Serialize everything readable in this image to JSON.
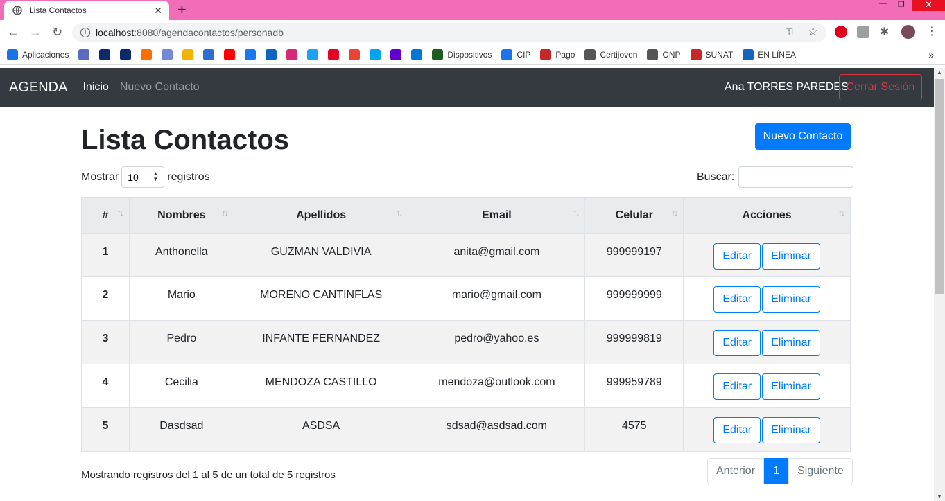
{
  "browser": {
    "tab_title": "Lista Contactos",
    "url_host": "localhost",
    "url_path": ":8080/agendacontactos/personadb",
    "bookmarks": [
      {
        "label": "Aplicaciones",
        "color": "#1a73e8"
      },
      {
        "label": "",
        "color": "#5b6bbf"
      },
      {
        "label": "",
        "color": "#0a2a6b"
      },
      {
        "label": "",
        "color": "#0a2a6b"
      },
      {
        "label": "",
        "color": "#ff6f00"
      },
      {
        "label": "",
        "color": "#7289da"
      },
      {
        "label": "",
        "color": "#f0b400"
      },
      {
        "label": "",
        "color": "#2c6fd1"
      },
      {
        "label": "",
        "color": "#ff0000"
      },
      {
        "label": "",
        "color": "#1877f2"
      },
      {
        "label": "",
        "color": "#0a66c2"
      },
      {
        "label": "",
        "color": "#d62976"
      },
      {
        "label": "",
        "color": "#1da1f2"
      },
      {
        "label": "",
        "color": "#e60023"
      },
      {
        "label": "",
        "color": "#ea4335"
      },
      {
        "label": "",
        "color": "#00a4ef"
      },
      {
        "label": "",
        "color": "#6001d2"
      },
      {
        "label": "",
        "color": "#0078d4"
      },
      {
        "label": "Dispositivos",
        "color": "#1b5e20"
      },
      {
        "label": "CIP",
        "color": "#1a73e8"
      },
      {
        "label": "Pago",
        "color": "#c62828"
      },
      {
        "label": "Certijoven",
        "color": "#555555"
      },
      {
        "label": "ONP",
        "color": "#555555"
      },
      {
        "label": "SUNAT",
        "color": "#c62828"
      },
      {
        "label": "EN LÍNEA",
        "color": "#1565c0"
      }
    ]
  },
  "navbar": {
    "brand": "AGENDA",
    "links": [
      "Inicio",
      "Nuevo Contacto"
    ],
    "user": "Ana TORRES PAREDES",
    "logout": "Cerrar Sesión"
  },
  "page": {
    "title": "Lista Contactos",
    "new_button": "Nuevo Contacto",
    "show_label": "Mostrar",
    "show_value": "10",
    "records_label": "registros",
    "search_label": "Buscar:",
    "info": "Mostrando registros del 1 al 5 de un total de 5 registros",
    "pager": {
      "prev": "Anterior",
      "current": "1",
      "next": "Siguiente"
    }
  },
  "table": {
    "headers": [
      "#",
      "Nombres",
      "Apellidos",
      "Email",
      "Celular",
      "Acciones"
    ],
    "edit_label": "Editar",
    "delete_label": "Eliminar",
    "rows": [
      {
        "id": "1",
        "nombres": "Anthonella",
        "apellidos": "GUZMAN VALDIVIA",
        "email": "anita@gmail.com",
        "celular": "999999197"
      },
      {
        "id": "2",
        "nombres": "Mario",
        "apellidos": "MORENO CANTINFLAS",
        "email": "mario@gmail.com",
        "celular": "999999999"
      },
      {
        "id": "3",
        "nombres": "Pedro",
        "apellidos": "INFANTE FERNANDEZ",
        "email": "pedro@yahoo.es",
        "celular": "999999819"
      },
      {
        "id": "4",
        "nombres": "Cecilia",
        "apellidos": "MENDOZA CASTILLO",
        "email": "mendoza@outlook.com",
        "celular": "999959789"
      },
      {
        "id": "5",
        "nombres": "Dasdsad",
        "apellidos": "ASDSA",
        "email": "sdsad@asdsad.com",
        "celular": "4575"
      }
    ]
  }
}
